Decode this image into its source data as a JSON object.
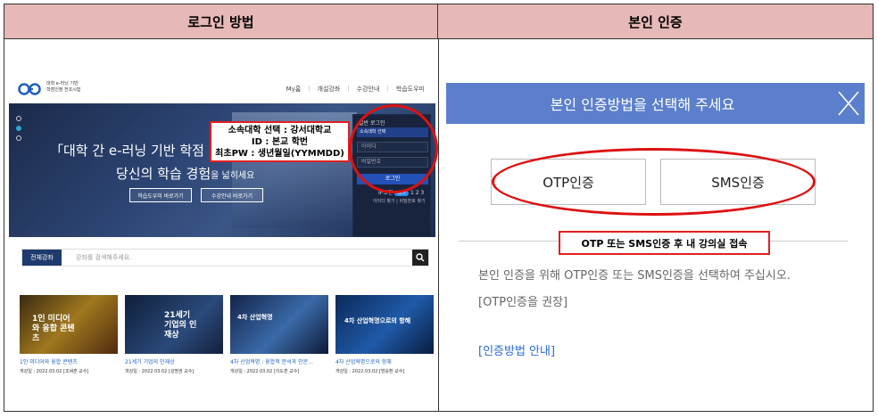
{
  "headers": {
    "left": "로그인 방법",
    "right": "본인 인증"
  },
  "site": {
    "logo_text_line1": "대학 e-러닝 기반",
    "logo_text_line2": "학점인정 전조시험",
    "nav": [
      "My홈",
      "개설강좌",
      "수강안내",
      "학습도우미"
    ],
    "hero_line1": "「대학 간 e-러닝 기반 학점",
    "hero_line2_main": "당신의 학습 경험",
    "hero_line2_small": "을 넓히세요",
    "hero_btn1": "학습도우미 바로가기",
    "hero_btn2": "수강안내 바로가기",
    "login": {
      "title": "일반 로그인",
      "select": "소속대학 선택",
      "id_placeholder": "아이디",
      "pw_placeholder": "비밀번호",
      "button": "로그인",
      "ip_label": "IP보안",
      "ip_toggle": "OFF",
      "ip_steps": "1  2  3",
      "links": "아이디 찾기  |  비밀번호 찾기"
    },
    "callout": {
      "line1": "소속대학 선택 : 강서대학교",
      "line2": "ID : 본교 학번",
      "line3": "최초PW : 생년월일(YYMMDD)"
    },
    "search": {
      "tab": "전체강좌",
      "placeholder": "강좌를 검색해주세요."
    },
    "courses": [
      {
        "thumb_text": "1인 미디어와 융합 콘텐츠",
        "title": "1인 미디어와 융합 콘텐츠",
        "date": "개강일 : 2022.03.02 [조세훈 교수]"
      },
      {
        "thumb_text": "21세기 기업의 인재상",
        "title": "21세기 기업의 인재상",
        "date": "개강일 : 2022.03.02 [김명권 교수]"
      },
      {
        "thumb_text": "4차 산업혁명",
        "title": "4차 산업혁명 : 융합적 분석과 인문...",
        "date": "개강일 : 2022.03.02 [이도훈 교수]"
      },
      {
        "thumb_text": "4차 산업혁명으로의 항해",
        "title": "4차 산업혁명으로의 항해",
        "date": "개강일 : 2022.03.02 [방승환 교수]"
      }
    ]
  },
  "auth": {
    "modal_title": "본인 인증방법을 선택해 주세요",
    "otp_button": "OTP인증",
    "sms_button": "SMS인증",
    "callout": "OTP 또는 SMS인증 후 내 강의실 접속",
    "desc1": "본인 인증을 위해 OTP인증 또는 SMS인증을 선택하여 주십시오.",
    "desc2": "[OTP인증을 권장]",
    "guide_link": "[인증방법 안내]"
  },
  "colors": {
    "header_bg": "#e6b8b7",
    "modal_blue": "#5b7fcc",
    "highlight_red": "#e02020",
    "link_blue": "#2a6ad4"
  }
}
